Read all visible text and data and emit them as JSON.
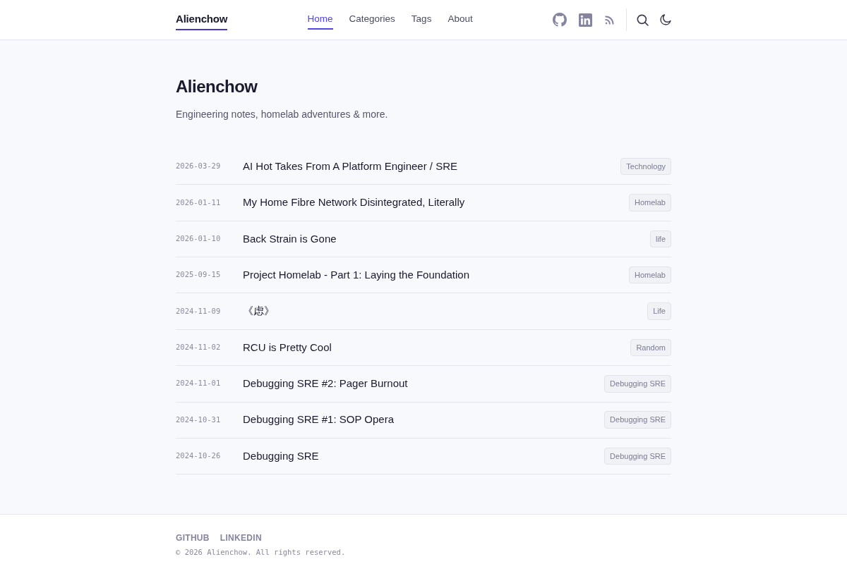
{
  "header": {
    "brand": "Alienchow",
    "nav": [
      {
        "label": "Home",
        "selected": true
      },
      {
        "label": "Categories",
        "selected": false
      },
      {
        "label": "Tags",
        "selected": false
      },
      {
        "label": "About",
        "selected": false
      }
    ]
  },
  "hero": {
    "title": "Alienchow",
    "subtitle": "Engineering notes, homelab adventures & more."
  },
  "posts": [
    {
      "date": "2026-03-29",
      "title": "AI Hot Takes From A Platform Engineer / SRE",
      "tag": "Technology"
    },
    {
      "date": "2026-01-11",
      "title": "My Home Fibre Network Disintegrated, Literally",
      "tag": "Homelab"
    },
    {
      "date": "2026-01-10",
      "title": "Back Strain is Gone",
      "tag": "life"
    },
    {
      "date": "2025-09-15",
      "title": "Project Homelab - Part 1: Laying the Foundation",
      "tag": "Homelab"
    },
    {
      "date": "2024-11-09",
      "title": "《虑》",
      "tag": "Life"
    },
    {
      "date": "2024-11-02",
      "title": "RCU is Pretty Cool",
      "tag": "Random"
    },
    {
      "date": "2024-11-01",
      "title": "Debugging SRE #2: Pager Burnout",
      "tag": "Debugging SRE"
    },
    {
      "date": "2024-10-31",
      "title": "Debugging SRE #1: SOP Opera",
      "tag": "Debugging SRE"
    },
    {
      "date": "2024-10-26",
      "title": "Debugging SRE",
      "tag": "Debugging SRE"
    }
  ],
  "footer": {
    "links": [
      "GITHUB",
      "LINKEDIN"
    ],
    "copyright": "© 2026 Alienchow. All rights reserved."
  }
}
